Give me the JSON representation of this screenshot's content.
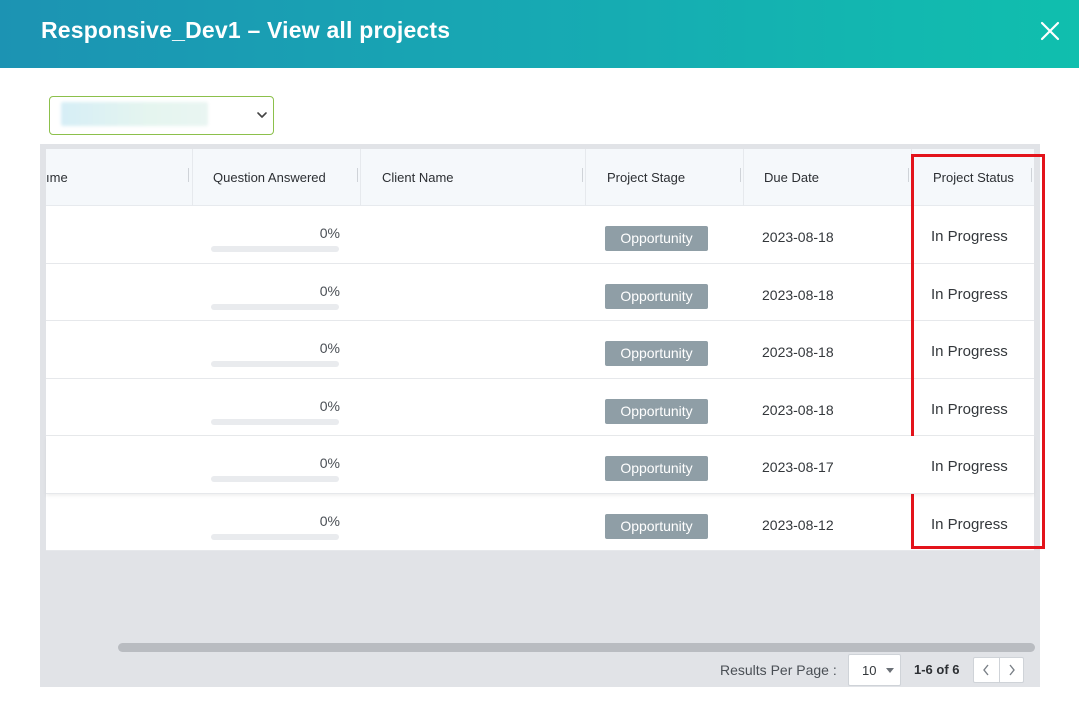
{
  "header": {
    "title": "Responsive_Dev1 – View all projects",
    "close_icon": "close-icon"
  },
  "filter": {
    "selected_value": "",
    "icon": "chevron-down-icon"
  },
  "table": {
    "columns": [
      "ıme",
      "Question Answered",
      "Client Name",
      "Project Stage",
      "Due Date",
      "Project Status"
    ],
    "rows": [
      {
        "name": "",
        "answered": "0%",
        "answered_fraction": 0,
        "client": "",
        "stage": "Opportunity",
        "due": "2023-08-18",
        "status": "In Progress"
      },
      {
        "name": "",
        "answered": "0%",
        "answered_fraction": 0,
        "client": "",
        "stage": "Opportunity",
        "due": "2023-08-18",
        "status": "In Progress"
      },
      {
        "name": "",
        "answered": "0%",
        "answered_fraction": 0,
        "client": "",
        "stage": "Opportunity",
        "due": "2023-08-18",
        "status": "In Progress"
      },
      {
        "name": "",
        "answered": "0%",
        "answered_fraction": 0,
        "client": "",
        "stage": "Opportunity",
        "due": "2023-08-18",
        "status": "In Progress"
      },
      {
        "name": "",
        "answered": "0%",
        "answered_fraction": 0,
        "client": "",
        "stage": "Opportunity",
        "due": "2023-08-17",
        "status": "In Progress"
      },
      {
        "name": "",
        "answered": "0%",
        "answered_fraction": 0,
        "client": "",
        "stage": "Opportunity",
        "due": "2023-08-12",
        "status": "In Progress"
      }
    ]
  },
  "pagination": {
    "results_per_page_label": "Results Per Page :",
    "per_page_value": "10",
    "range_text": "1-6 of 6"
  },
  "colors": {
    "header_start": "#1c93b3",
    "header_end": "#10bfae",
    "badge": "#8f9ea6",
    "highlight": "#e3131b",
    "accent": "#8cc04b"
  }
}
